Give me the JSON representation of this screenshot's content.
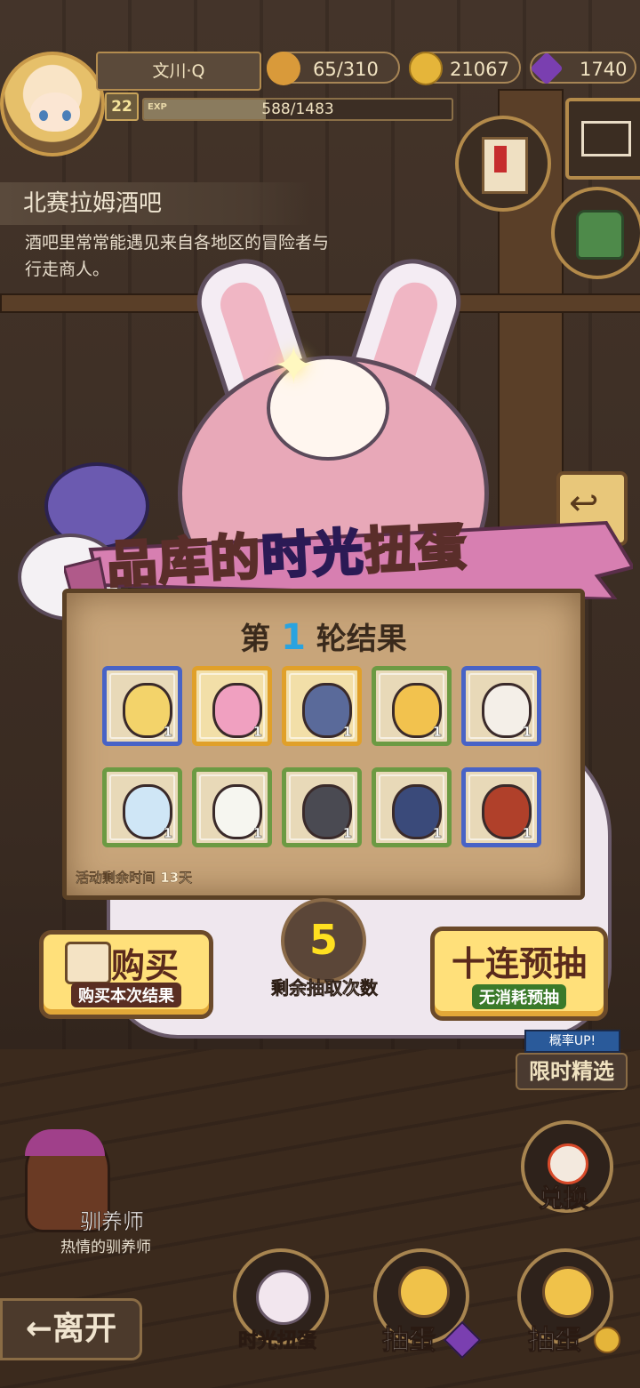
{
  "player": {
    "name": "文川·Q",
    "level": "22",
    "exp_label": "EXP",
    "exp_text": "588/1483",
    "exp_progress": 0.3965
  },
  "resources": {
    "stamina": "65/310",
    "gold": "21067",
    "gems": "1740"
  },
  "location": {
    "title": "北赛拉姆酒吧",
    "description": "酒吧里常常能遇见来自各地区的冒险者与行走商人。"
  },
  "event": {
    "title_part1": "品库的",
    "title_part2": "时光",
    "title_part3": "扭蛋",
    "round_prefix": "第",
    "round_number": "1",
    "round_suffix": "轮结果",
    "time_left": "活动剩余时间 13天"
  },
  "items": [
    {
      "name": "yellow-hood-icon",
      "rarity": "blue",
      "qty": "1"
    },
    {
      "name": "cupcake-icon",
      "rarity": "gold",
      "qty": "1"
    },
    {
      "name": "feather-shield-icon",
      "rarity": "gold",
      "qty": "1"
    },
    {
      "name": "golden-egg-icon",
      "rarity": "green",
      "qty": "1"
    },
    {
      "name": "sheep-fleece-icon",
      "rarity": "blue",
      "qty": "1"
    },
    {
      "name": "water-drop-icon",
      "rarity": "green",
      "qty": "1"
    },
    {
      "name": "radish-icon",
      "rarity": "green",
      "qty": "1"
    },
    {
      "name": "iron-helmet-icon",
      "rarity": "green",
      "qty": "1"
    },
    {
      "name": "blue-plum-icon",
      "rarity": "green",
      "qty": "1"
    },
    {
      "name": "flame-beast-icon",
      "rarity": "blue",
      "qty": "1"
    }
  ],
  "draws": {
    "remaining": "5",
    "label": "剩余抽取次数"
  },
  "buttons": {
    "buy_main": "购买",
    "buy_sub": "购买本次结果",
    "ten_main": "十连预抽",
    "ten_sub": "无消耗预抽"
  },
  "side": {
    "limited_tag": "概率UP!",
    "limited_label": "限时精选",
    "exchange_label": "兑换"
  },
  "npc": {
    "name": "驯养师",
    "subtitle": "热情的驯养师"
  },
  "bottom": {
    "leave": "←离开",
    "time_gacha": "时光扭蛋",
    "draw_gem": "抽蛋",
    "draw_gold": "抽蛋"
  },
  "colors": {
    "accent_gold": "#ffe07a",
    "rarity_blue": "#4863c6",
    "rarity_gold": "#e0a02a",
    "rarity_green": "#6c9a43",
    "draw_number": "#ffe020"
  }
}
